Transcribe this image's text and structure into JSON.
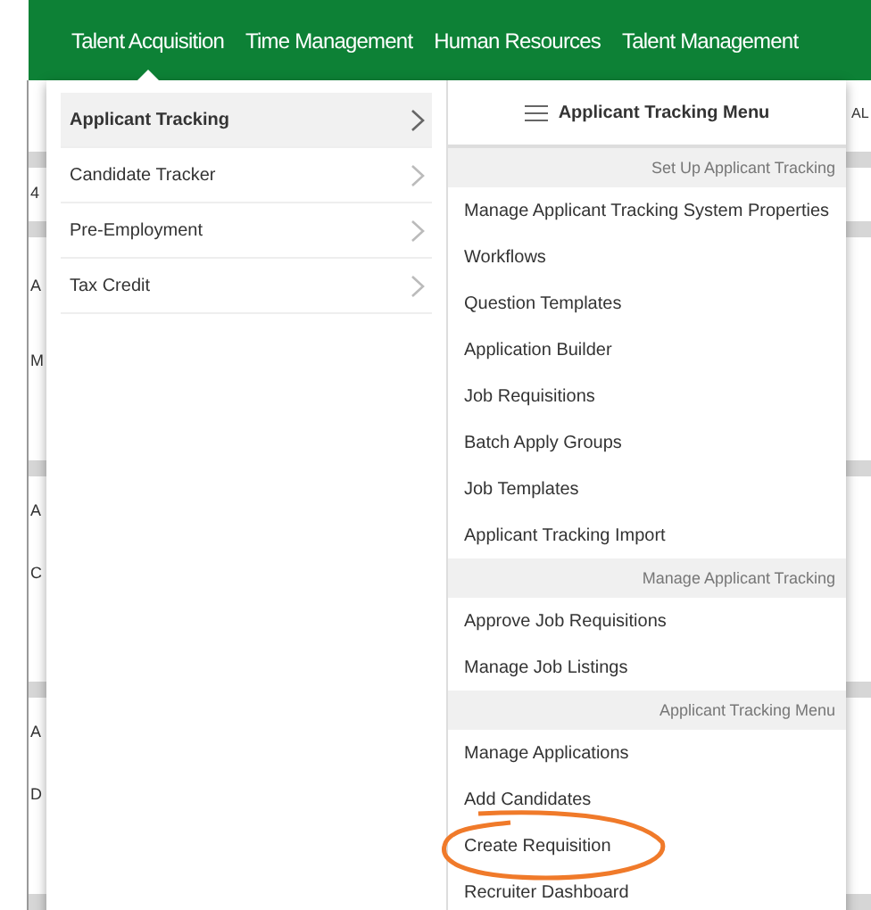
{
  "nav": [
    {
      "label": "Talent Acquisition",
      "selected": true
    },
    {
      "label": "Time Management",
      "selected": false
    },
    {
      "label": "Human Resources",
      "selected": false
    },
    {
      "label": "Talent Management",
      "selected": false
    }
  ],
  "background_fragments": [
    {
      "text": "4"
    },
    {
      "text": "A"
    },
    {
      "text": "M"
    },
    {
      "text": "A"
    },
    {
      "text": "C"
    },
    {
      "text": "A"
    },
    {
      "text": "D"
    }
  ],
  "background_right_fragment": "AL",
  "categories": [
    {
      "label": "Applicant Tracking",
      "selected": true
    },
    {
      "label": "Candidate Tracker",
      "selected": false
    },
    {
      "label": "Pre-Employment",
      "selected": false
    },
    {
      "label": "Tax Credit",
      "selected": false
    }
  ],
  "submenu": {
    "title": "Applicant Tracking Menu",
    "items": [
      {
        "kind": "section",
        "label": "Set Up Applicant Tracking"
      },
      {
        "kind": "link",
        "label": "Manage Applicant Tracking System Properties",
        "circled": false
      },
      {
        "kind": "link",
        "label": "Workflows",
        "circled": false
      },
      {
        "kind": "link",
        "label": "Question Templates",
        "circled": false
      },
      {
        "kind": "link",
        "label": "Application Builder",
        "circled": false
      },
      {
        "kind": "link",
        "label": "Job Requisitions",
        "circled": false
      },
      {
        "kind": "link",
        "label": "Batch Apply Groups",
        "circled": false
      },
      {
        "kind": "link",
        "label": "Job Templates",
        "circled": false
      },
      {
        "kind": "link",
        "label": "Applicant Tracking Import",
        "circled": false
      },
      {
        "kind": "section",
        "label": "Manage Applicant Tracking"
      },
      {
        "kind": "link",
        "label": "Approve Job Requisitions",
        "circled": false
      },
      {
        "kind": "link",
        "label": "Manage Job Listings",
        "circled": false
      },
      {
        "kind": "section",
        "label": "Applicant Tracking Menu"
      },
      {
        "kind": "link",
        "label": "Manage Applications",
        "circled": false
      },
      {
        "kind": "link",
        "label": "Add Candidates",
        "circled": false
      },
      {
        "kind": "link",
        "label": "Create Requisition",
        "circled": true
      },
      {
        "kind": "link",
        "label": "Recruiter Dashboard",
        "circled": false
      }
    ]
  }
}
